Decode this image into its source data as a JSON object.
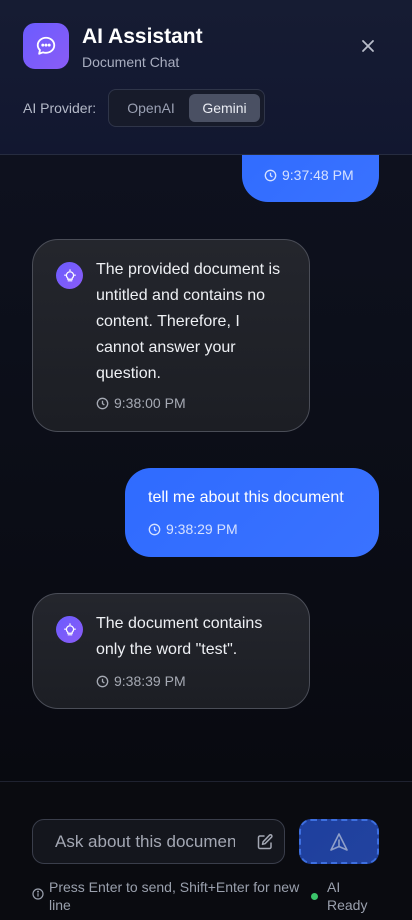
{
  "header": {
    "title": "AI Assistant",
    "subtitle": "Document Chat",
    "provider_label": "AI Provider:",
    "providers": [
      {
        "label": "OpenAI",
        "selected": false
      },
      {
        "label": "Gemini",
        "selected": true
      }
    ],
    "icons": {
      "app": "chat-bubble-icon",
      "close": "close-icon"
    }
  },
  "messages": [
    {
      "role": "user",
      "text": "",
      "time": "9:37:48 PM"
    },
    {
      "role": "assistant",
      "text": "The provided document is untitled and contains no content. Therefore, I cannot answer your question.",
      "time": "9:38:00 PM"
    },
    {
      "role": "user",
      "text": "tell me about this document",
      "time": "9:38:29 PM"
    },
    {
      "role": "assistant",
      "text": "The document contains only the word \"test\".",
      "time": "9:38:39 PM"
    }
  ],
  "composer": {
    "placeholder": "Ask about this document...",
    "value": "",
    "hint": "Press Enter to send, Shift+Enter for new line",
    "status": "AI Ready"
  },
  "colors": {
    "accent": "#2f6bff",
    "brand_gradient_start": "#6b5cff",
    "brand_gradient_end": "#8a5cf6",
    "status_ready": "#3bc46a"
  }
}
